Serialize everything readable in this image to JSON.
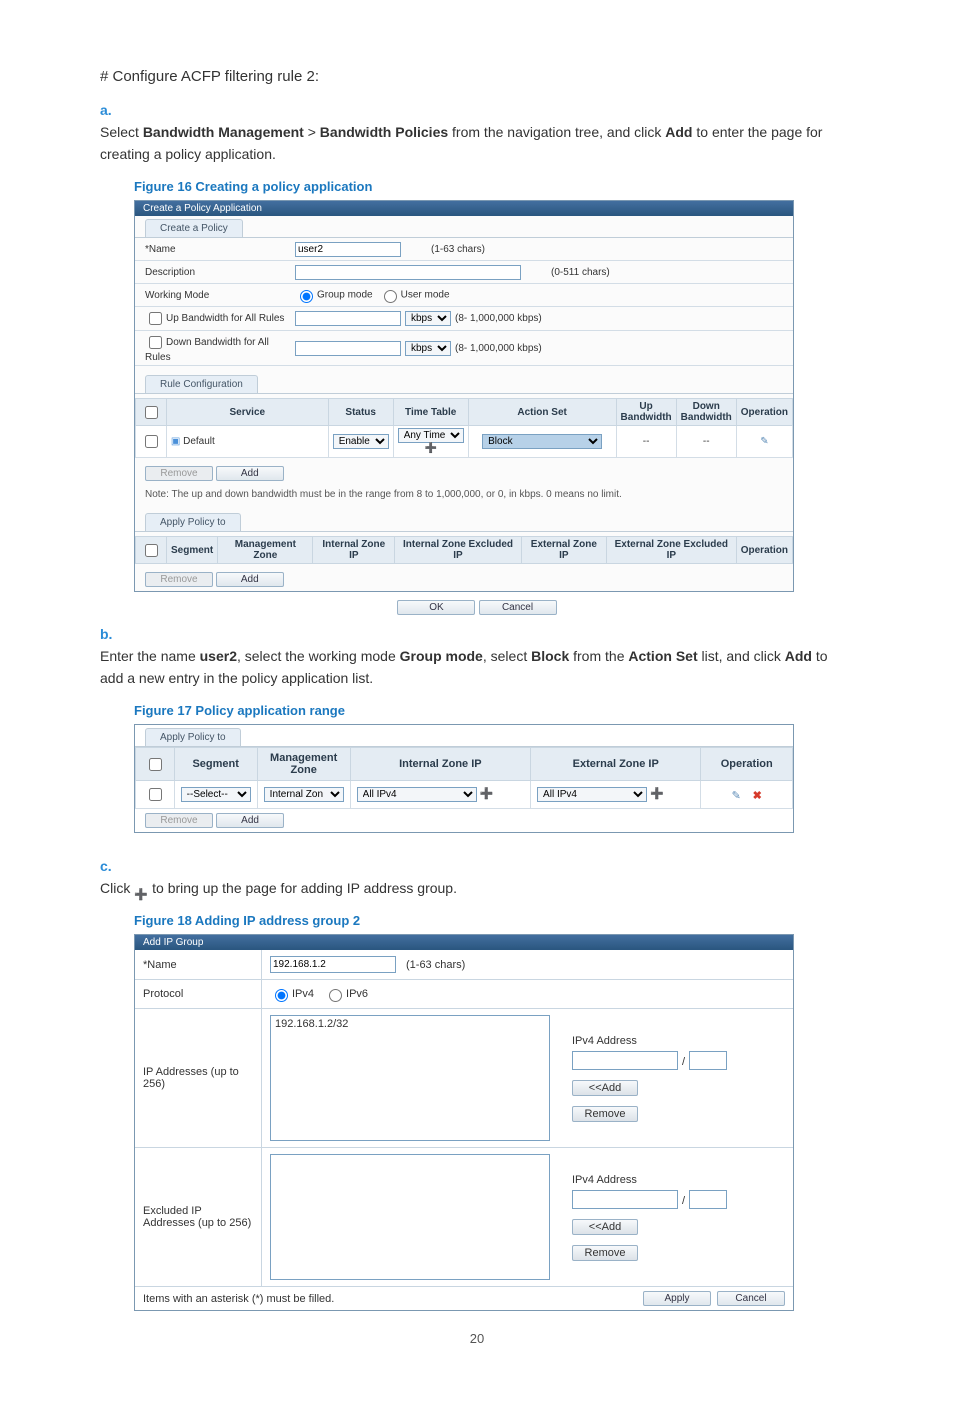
{
  "heading": "# Configure ACFP filtering rule 2:",
  "step_a_1": "Select ",
  "step_a_b1": "Bandwidth Management",
  "step_a_2": " > ",
  "step_a_b2": "Bandwidth Policies",
  "step_a_3": " from the navigation tree, and click ",
  "step_a_b3": "Add",
  "step_a_4": " to enter the page for creating a policy application.",
  "fig16_title": "Figure 16 Creating a policy application",
  "fig16": {
    "panel_title": "Create a Policy Application",
    "tab": "Create a Policy",
    "name_label": "*Name",
    "name_value": "user2",
    "name_hint": "(1-63  chars)",
    "desc_label": "Description",
    "desc_hint": "(0-511  chars)",
    "mode_label": "Working Mode",
    "mode_group": "Group mode",
    "mode_user": "User mode",
    "up_bw_label": "Up Bandwidth for All Rules",
    "down_bw_label": "Down Bandwidth for All Rules",
    "bw_unit": "kbps",
    "bw_hint": "(8- 1,000,000 kbps)",
    "rule_conf_tab": "Rule Configuration",
    "cols": [
      "",
      "Service",
      "Status",
      "Time Table",
      "Action Set",
      "Up Bandwidth",
      "Down Bandwidth",
      "Operation"
    ],
    "row": {
      "service": "Default",
      "status": "Enable",
      "time": "Any Time",
      "action": "Block",
      "up": "--",
      "down": "--"
    },
    "remove": "Remove",
    "add": "Add",
    "note": "Note: The up and down bandwidth must be in the range from 8 to 1,000,000, or 0, in kbps. 0 means no limit.",
    "apply_tab": "Apply Policy to",
    "cols2": [
      "",
      "Segment",
      "Management Zone",
      "Internal Zone IP",
      "Internal Zone Excluded IP",
      "External Zone IP",
      "External Zone Excluded IP",
      "Operation"
    ],
    "ok": "OK",
    "cancel": "Cancel"
  },
  "step_b_letter": "b.",
  "step_b_1": "Enter the name ",
  "step_b_b1": "user2",
  "step_b_2": ", select the working mode ",
  "step_b_b2": "Group mode",
  "step_b_3": ", select ",
  "step_b_b3": "Block",
  "step_b_4": " from the ",
  "step_b_b4": "Action Set",
  "step_b_5": " list, and click ",
  "step_b_b5": "Add",
  "step_b_6": " to add a new entry in the policy application list.",
  "fig17_title": "Figure 17 Policy application range",
  "fig17": {
    "tab": "Apply Policy to",
    "cols": [
      "",
      "Segment",
      "Management Zone",
      "Internal Zone IP",
      "External Zone IP",
      "Operation"
    ],
    "segment": "--Select--",
    "mgmt": "Internal Zon",
    "int_ip": "All IPv4",
    "ext_ip": "All IPv4",
    "remove": "Remove",
    "add": "Add"
  },
  "step_c_letter": "c.",
  "step_c_1": "Click ",
  "step_c_2": " to bring up the page for adding IP address group.",
  "fig18_title": "Figure 18 Adding IP address group 2",
  "fig18": {
    "panel_title": "Add IP Group",
    "name_label": "*Name",
    "name_value": "192.168.1.2",
    "name_hint": "(1-63  chars)",
    "proto_label": "Protocol",
    "proto_v4": "IPv4",
    "proto_v6": "IPv6",
    "ip_label": "IP Addresses (up to 256)",
    "ip_list": "192.168.1.2/32",
    "ipv4_label": "IPv4 Address",
    "slash": "/",
    "add_btn": "<<Add",
    "remove_btn": "Remove",
    "excl_label": "Excluded IP Addresses (up to 256)",
    "footer_msg": "Items with an asterisk (*) must be filled.",
    "apply": "Apply",
    "cancel": "Cancel"
  },
  "page_num": "20",
  "step_a_letter": "a."
}
